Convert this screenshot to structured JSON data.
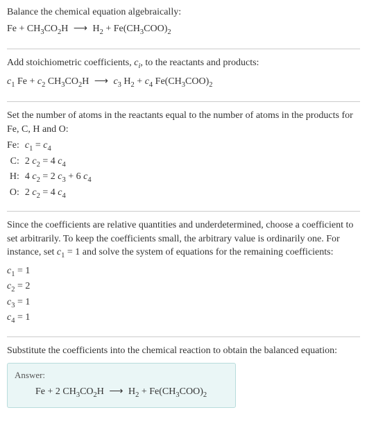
{
  "section1": {
    "intro": "Balance the chemical equation algebraically:",
    "eq_lhs1": "Fe + CH",
    "eq_lhs2": "CO",
    "eq_lhs3": "H",
    "eq_rhs1": "H",
    "eq_rhs2": " + Fe(CH",
    "eq_rhs3": "COO)"
  },
  "section2": {
    "intro_a": "Add stoichiometric coefficients, ",
    "intro_ci": "c",
    "intro_ci_sub": "i",
    "intro_b": ", to the reactants and products:",
    "c1": "c",
    "c1s": "1",
    "t1": " Fe + ",
    "c2": "c",
    "c2s": "2",
    "t2": " CH",
    "t3": "CO",
    "t4": "H",
    "c3": "c",
    "c3s": "3",
    "t5": " H",
    "t6": " + ",
    "c4": "c",
    "c4s": "4",
    "t7": " Fe(CH",
    "t8": "COO)"
  },
  "section3": {
    "intro": "Set the number of atoms in the reactants equal to the number of atoms in the products for Fe, C, H and O:",
    "rows": [
      {
        "label": "Fe:",
        "lhs_pre": "",
        "c_a": "c",
        "c_as": "1",
        "mid": " = ",
        "rhs_pre": "",
        "c_b": "c",
        "c_bs": "4",
        "rhs_post": ""
      },
      {
        "label": "C:",
        "lhs_pre": "2 ",
        "c_a": "c",
        "c_as": "2",
        "mid": " = 4 ",
        "rhs_pre": "",
        "c_b": "c",
        "c_bs": "4",
        "rhs_post": ""
      },
      {
        "label": "H:",
        "lhs_pre": "4 ",
        "c_a": "c",
        "c_as": "2",
        "mid": " = 2 ",
        "rhs_pre": "",
        "c_b": "c",
        "c_bs": "3",
        "rhs_post": " + 6 ",
        "c_c": "c",
        "c_cs": "4"
      },
      {
        "label": "O:",
        "lhs_pre": "2 ",
        "c_a": "c",
        "c_as": "2",
        "mid": " = 4 ",
        "rhs_pre": "",
        "c_b": "c",
        "c_bs": "4",
        "rhs_post": ""
      }
    ]
  },
  "section4": {
    "intro_a": "Since the coefficients are relative quantities and underdetermined, choose a coefficient to set arbitrarily. To keep the coefficients small, the arbitrary value is ordinarily one. For instance, set ",
    "set_c": "c",
    "set_cs": "1",
    "intro_b": " = 1 and solve the system of equations for the remaining coefficients:",
    "coefs": [
      {
        "c": "c",
        "cs": "1",
        "val": " = 1"
      },
      {
        "c": "c",
        "cs": "2",
        "val": " = 2"
      },
      {
        "c": "c",
        "cs": "3",
        "val": " = 1"
      },
      {
        "c": "c",
        "cs": "4",
        "val": " = 1"
      }
    ]
  },
  "section5": {
    "intro": "Substitute the coefficients into the chemical reaction to obtain the balanced equation:",
    "answer_label": "Answer:",
    "eq_a": "Fe + 2 CH",
    "eq_b": "CO",
    "eq_c": "H",
    "eq_d": "H",
    "eq_e": " + Fe(CH",
    "eq_f": "COO)"
  },
  "sub3": "3",
  "sub2": "2",
  "arrow": "⟶",
  "chart_data": {
    "type": "table",
    "title": "Atom balance equations",
    "rows": [
      {
        "element": "Fe",
        "equation": "c1 = c4"
      },
      {
        "element": "C",
        "equation": "2 c2 = 4 c4"
      },
      {
        "element": "H",
        "equation": "4 c2 = 2 c3 + 6 c4"
      },
      {
        "element": "O",
        "equation": "2 c2 = 4 c4"
      }
    ],
    "solution": {
      "c1": 1,
      "c2": 2,
      "c3": 1,
      "c4": 1
    },
    "balanced_equation": "Fe + 2 CH3CO2H ⟶ H2 + Fe(CH3COO)2"
  }
}
